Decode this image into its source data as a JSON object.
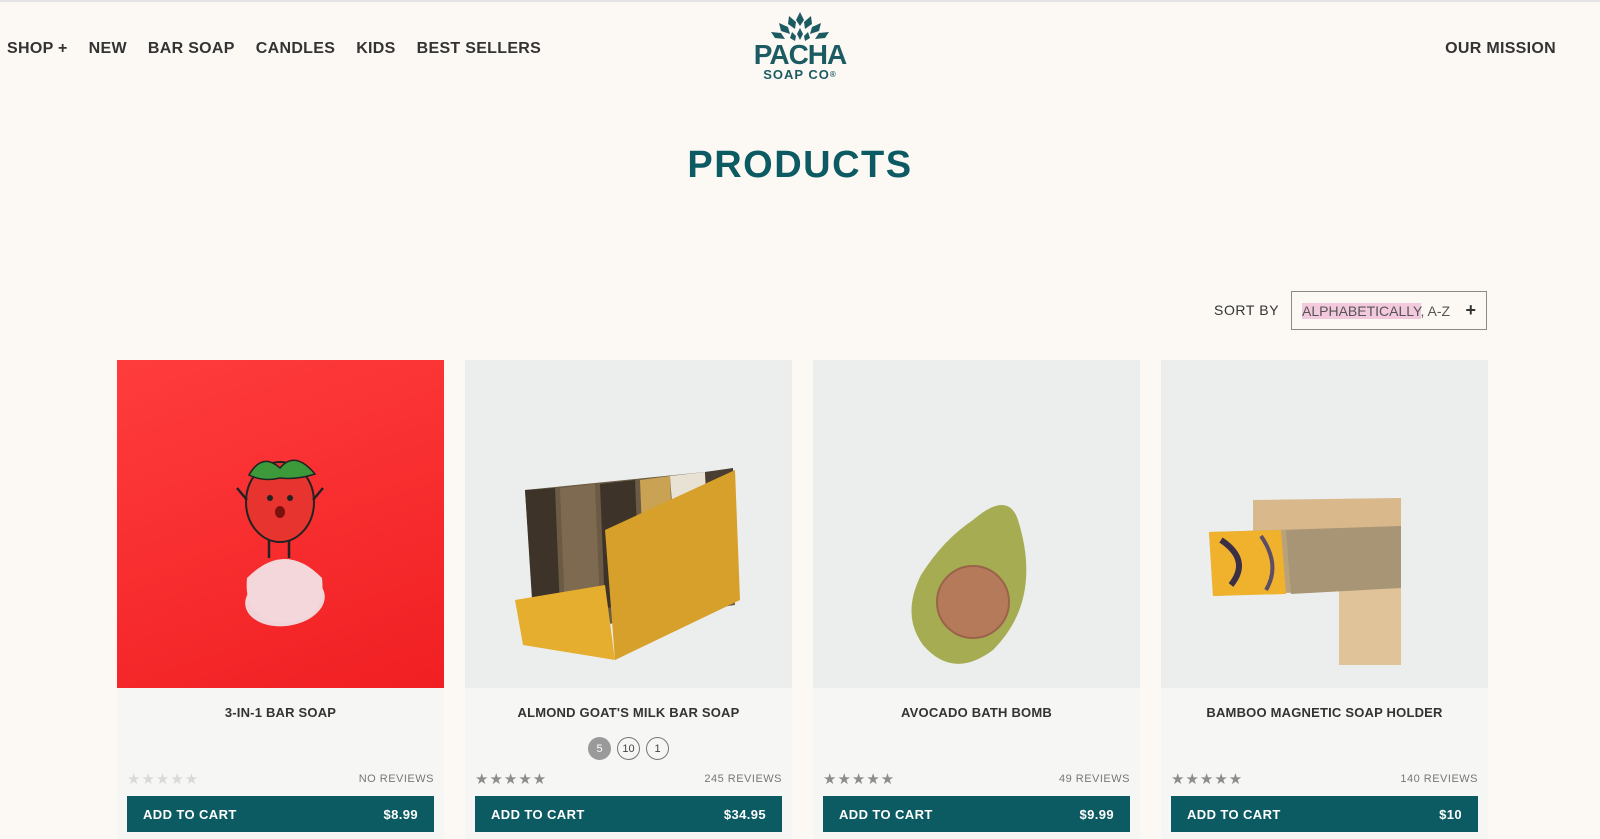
{
  "nav": {
    "left": [
      "SHOP +",
      "NEW",
      "BAR SOAP",
      "CANDLES",
      "KIDS",
      "BEST SELLERS"
    ],
    "right": "OUR MISSION"
  },
  "logo": {
    "word": "PACHA",
    "sub": "SOAP CO",
    "mark": "®",
    "icon": "flower-icon"
  },
  "page_title": "PRODUCTS",
  "sort": {
    "label": "SORT BY",
    "value_highlight": "ALPHABETICALLY",
    "value_rest": ", A-Z",
    "toggle": "+"
  },
  "colors": {
    "brand_teal": "#0d5b62",
    "background": "#fcf9f4",
    "highlight": "#f3c9dd"
  },
  "products": [
    {
      "name": "3-IN-1 BAR SOAP",
      "image": "strawberry-kids-soap-photo",
      "rating": 0,
      "stars": "★★★★★",
      "reviews": "NO REVIEWS",
      "cart_label": "ADD TO CART",
      "price": "$8.99",
      "variants": []
    },
    {
      "name": "ALMOND GOAT'S MILK BAR SOAP",
      "image": "almond-goats-milk-box-photo",
      "rating": 4.5,
      "stars": "★★★★★",
      "reviews": "245 REVIEWS",
      "cart_label": "ADD TO CART",
      "price": "$34.95",
      "variants": [
        "5",
        "10",
        "1"
      ]
    },
    {
      "name": "AVOCADO BATH BOMB",
      "image": "avocado-bath-bomb-photo",
      "rating": 4.5,
      "stars": "★★★★★",
      "reviews": "49 REVIEWS",
      "cart_label": "ADD TO CART",
      "price": "$9.99",
      "variants": []
    },
    {
      "name": "BAMBOO MAGNETIC SOAP HOLDER",
      "image": "bamboo-soap-holder-photo",
      "rating": 4.5,
      "stars": "★★★★★",
      "reviews": "140 REVIEWS",
      "cart_label": "ADD TO CART",
      "price": "$10",
      "variants": []
    }
  ]
}
